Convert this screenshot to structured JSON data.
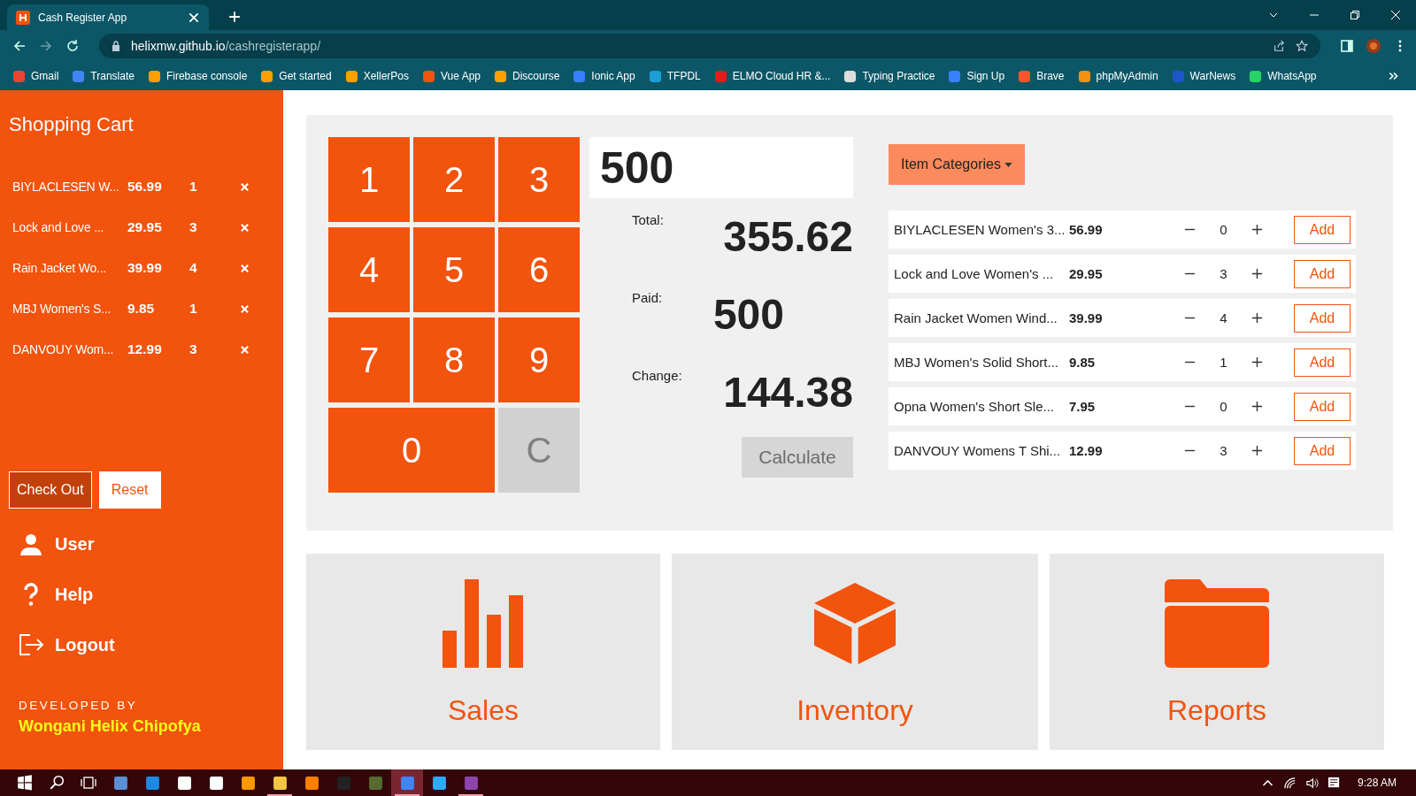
{
  "browser": {
    "tab_title": "Cash Register App",
    "address_host": "helixmw.github.io",
    "address_path": "/cashregisterapp/",
    "bookmarks": [
      "Gmail",
      "Translate",
      "Firebase console",
      "Get started",
      "XellerPos",
      "Vue App",
      "Discourse",
      "Ionic App",
      "TFPDL",
      "ELMO Cloud HR &...",
      "Typing Practice",
      "Sign Up",
      "Brave",
      "phpMyAdmin",
      "WarNews",
      "WhatsApp"
    ]
  },
  "sidebar": {
    "title": "Shopping Cart",
    "cart_items": [
      {
        "name": "BIYLACLESEN W...",
        "price": "56.99",
        "qty": "1"
      },
      {
        "name": "Lock and Love ...",
        "price": "29.95",
        "qty": "3"
      },
      {
        "name": "Rain Jacket Wo...",
        "price": "39.99",
        "qty": "4"
      },
      {
        "name": "MBJ Women's S...",
        "price": "9.85",
        "qty": "1"
      },
      {
        "name": "DANVOUY Wom...",
        "price": "12.99",
        "qty": "3"
      }
    ],
    "checkout_button": "Check Out",
    "reset_button": "Reset",
    "nav": [
      {
        "label": "User",
        "kind": "user"
      },
      {
        "label": "Help",
        "kind": "help"
      },
      {
        "label": "Logout",
        "kind": "logout"
      }
    ],
    "developed_by": "DEVELOPED BY",
    "developer": "Wongani Helix Chipofya"
  },
  "keypad": [
    {
      "label": "1",
      "kind": "digit"
    },
    {
      "label": "2",
      "kind": "digit"
    },
    {
      "label": "3",
      "kind": "digit"
    },
    {
      "label": "4",
      "kind": "digit"
    },
    {
      "label": "5",
      "kind": "digit"
    },
    {
      "label": "6",
      "kind": "digit"
    },
    {
      "label": "7",
      "kind": "digit"
    },
    {
      "label": "8",
      "kind": "digit"
    },
    {
      "label": "9",
      "kind": "digit"
    },
    {
      "label": "0",
      "kind": "zero"
    },
    {
      "label": "C",
      "kind": "clear"
    }
  ],
  "display": "500",
  "totals": [
    {
      "label": "Total:",
      "value": "355.62"
    },
    {
      "label": "Paid:",
      "value": "500"
    },
    {
      "label": "Change:",
      "value": "144.38"
    }
  ],
  "calculate_button": "Calculate",
  "categories_button": "Item Categories",
  "products": [
    {
      "name": "BIYLACLESEN Women's 3...",
      "price": "56.99",
      "qty": "0",
      "action": "Add"
    },
    {
      "name": "Lock and Love Women's ...",
      "price": "29.95",
      "qty": "3",
      "action": "Add"
    },
    {
      "name": "Rain Jacket Women Wind...",
      "price": "39.99",
      "qty": "4",
      "action": "Add"
    },
    {
      "name": "MBJ Women's Solid Short...",
      "price": "9.85",
      "qty": "1",
      "action": "Add"
    },
    {
      "name": "Opna Women's Short Sle...",
      "price": "7.95",
      "qty": "0",
      "action": "Add"
    },
    {
      "name": "DANVOUY Womens T Shi...",
      "price": "12.99",
      "qty": "3",
      "action": "Add"
    }
  ],
  "tiles": [
    {
      "label": "Sales",
      "kind": "sales"
    },
    {
      "label": "Inventory",
      "kind": "inventory"
    },
    {
      "label": "Reports",
      "kind": "reports"
    }
  ],
  "taskbar": {
    "apps": [
      {
        "running": false,
        "selected": false
      },
      {
        "running": false,
        "selected": false
      },
      {
        "running": false,
        "selected": false
      },
      {
        "running": false,
        "selected": false
      },
      {
        "running": false,
        "selected": false
      },
      {
        "running": true,
        "selected": false
      },
      {
        "running": false,
        "selected": false
      },
      {
        "running": false,
        "selected": false
      },
      {
        "running": false,
        "selected": false
      },
      {
        "running": true,
        "selected": true
      },
      {
        "running": false,
        "selected": false
      },
      {
        "running": true,
        "selected": false
      }
    ],
    "clock": "9:28 AM"
  }
}
